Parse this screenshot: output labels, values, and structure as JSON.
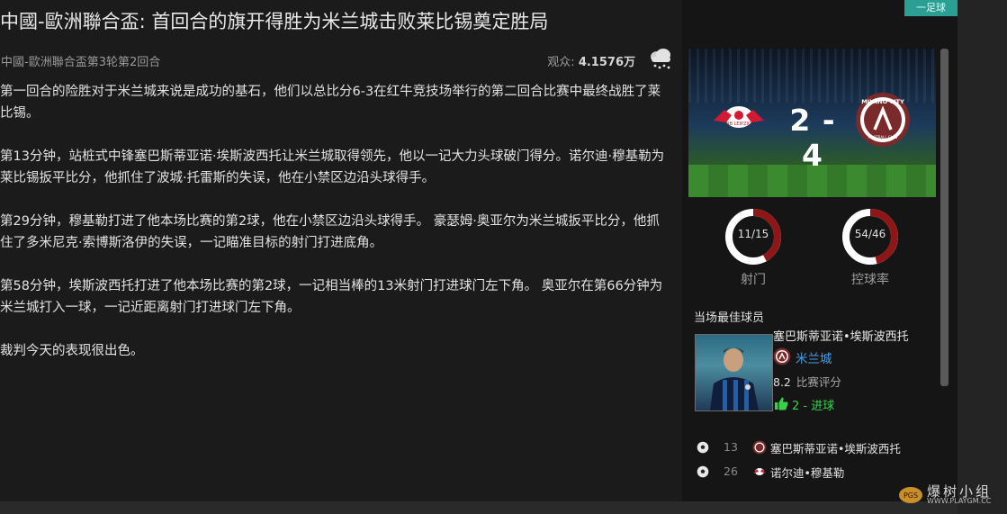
{
  "article": {
    "title": "中國-歐洲聯合盃: 首回合的旗开得胜为米兰城击败莱比锡奠定胜局",
    "league_round": "中國-歐洲聯合盃第3轮第2回合",
    "views_label": "观众:",
    "views_value": "4.1576万",
    "paragraphs": [
      "第一回合的险胜对于米兰城来说是成功的基石，他们以总比分6-3在红牛竞技场举行的第二回合比赛中最终战胜了莱比锡。",
      "第13分钟，站桩式中锋塞巴斯蒂亚诺·埃斯波西托让米兰城取得领先，他以一记大力头球破门得分。诺尔迪·穆基勒为莱比锡扳平比分，他抓住了波城·托雷斯的失误，他在小禁区边沿头球得手。",
      "第29分钟，穆基勒打进了他本场比赛的第2球，他在小禁区边沿头球得手。 豪瑟姆·奥亚尔为米兰城扳平比分，他抓住了多米尼克·索博斯洛伊的失误，一记瞄准目标的射门打进底角。",
      "第58分钟，埃斯波西托打进了他本场比赛的第2球，一记相当棒的13米射门打进球门左下角。 奥亚尔在第66分钟为米兰城打入一球，一记近距离射门打进球门左下角。",
      "裁判今天的表现很出色。"
    ]
  },
  "match": {
    "score_home": "2",
    "score_sep": "-",
    "score_away": "4",
    "home_crest_text": "RB LEIPZIG",
    "away_crest_text": "MILANO CITY",
    "away_crest_sub": "FOOTBALL CLUB"
  },
  "stats": [
    {
      "value": "11/15",
      "label": "射门",
      "fraction": 0.42
    },
    {
      "value": "54/46",
      "label": "控球率",
      "fraction": 0.46
    }
  ],
  "motm": {
    "title": "当场最佳球员",
    "name": "塞巴斯蒂亚诺•埃斯波西托",
    "club": "米兰城",
    "rating": "8.2",
    "rating_label": "比赛评分",
    "goals": "2 - 进球"
  },
  "events": [
    {
      "minute": "13",
      "player": "塞巴斯蒂亚诺•埃斯波西托",
      "team": "away"
    },
    {
      "minute": "26",
      "player": "诺尔迪•穆基勒",
      "team": "home"
    }
  ],
  "tag": "一足球",
  "watermark": {
    "text": "爆树小组",
    "url": "WWW.PLAYGM.CC",
    "logo_text": "PGS"
  },
  "colors": {
    "ring": "#8f1616",
    "ring_track": "#ffffff",
    "away_club": "#7a2a2a",
    "link": "#4a9de8",
    "goal": "#37d24a",
    "tag": "#2b9f93"
  }
}
